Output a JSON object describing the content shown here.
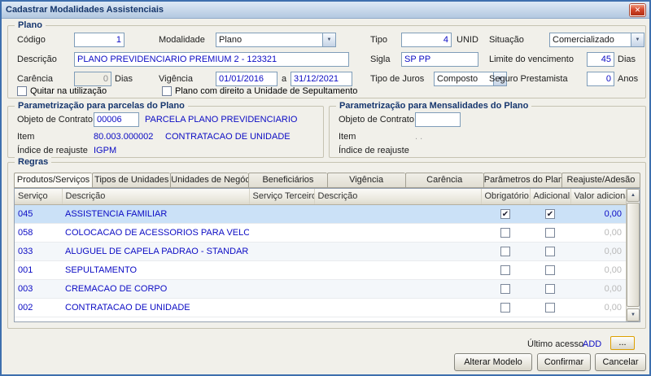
{
  "window": {
    "title": "Cadastrar Modalidades Assistenciais"
  },
  "icons": {
    "close": "✕",
    "dropdown": "▼",
    "scroll_up": "▲",
    "scroll_down": "▼"
  },
  "plano": {
    "legend": "Plano",
    "codigo": {
      "label": "Código",
      "value": "1"
    },
    "modalidade": {
      "label": "Modalidade",
      "value": "Plano"
    },
    "tipo": {
      "label": "Tipo",
      "value": "4",
      "suffix": "UNID"
    },
    "situacao": {
      "label": "Situação",
      "value": "Comercializado"
    },
    "descricao": {
      "label": "Descrição",
      "value": "PLANO PREVIDENCIARIO PREMIUM 2 - 123321"
    },
    "sigla": {
      "label": "Sigla",
      "value": "SP PP"
    },
    "limite": {
      "label": "Limite do vencimento",
      "value": "45",
      "suffix": "Dias"
    },
    "carencia": {
      "label": "Carência",
      "value": "0",
      "suffix": "Dias"
    },
    "vigencia": {
      "label": "Vigência",
      "start": "01/01/2016",
      "sep": "a",
      "end": "31/12/2021"
    },
    "juros": {
      "label": "Tipo de Juros",
      "value": "Composto"
    },
    "seguro": {
      "label": "Seguro Prestamista",
      "value": "0",
      "suffix": "Anos"
    },
    "quitar": {
      "label": "Quitar na utilização",
      "checked": ""
    },
    "direito": {
      "label": "Plano com direito a Unidade de Sepultamento",
      "checked": ""
    }
  },
  "parcelas": {
    "legend": "Parametrização para parcelas do Plano",
    "objeto": {
      "label": "Objeto de Contrato",
      "value": "00006",
      "desc": "PARCELA PLANO PREVIDENCIARIO"
    },
    "item": {
      "label": "Item",
      "value": "80.003.000002",
      "desc": "CONTRATACAO DE UNIDADE"
    },
    "indice": {
      "label": "Índice de reajuste",
      "value": "IGPM"
    }
  },
  "mensalidades": {
    "legend": "Parametrização para Mensalidades do Plano",
    "objeto": {
      "label": "Objeto de Contrato",
      "value": ""
    },
    "item": {
      "label": "Item",
      "value": ".  ."
    },
    "indice": {
      "label": "Índice de reajuste",
      "value": ""
    }
  },
  "regras": {
    "legend": "Regras",
    "tabs": [
      {
        "label": "Produtos/Serviços",
        "active": true
      },
      {
        "label": "Tipos de Unidades"
      },
      {
        "label": "Unidades de Negócio"
      },
      {
        "label": "Beneficiários"
      },
      {
        "label": "Vigência"
      },
      {
        "label": "Carência"
      },
      {
        "label": "Parâmetros do Plano"
      },
      {
        "label": "Reajuste/Adesão"
      }
    ],
    "table": {
      "headers": [
        "Serviço",
        "Descrição",
        "Serviço Terceiro",
        "Descrição",
        "Obrigatório",
        "Adicional",
        "Valor adicional"
      ],
      "rows": [
        {
          "servico": "045",
          "descricao": "ASSISTENCIA FAMILIAR",
          "servico_terceiro": "",
          "descricao2": "",
          "obrigatorio": "✔",
          "adicional": "✔",
          "valor": "0,00",
          "selected": true
        },
        {
          "servico": "058",
          "descricao": "COLOCACAO DE ACESSORIOS PARA VELORIO",
          "servico_terceiro": "",
          "descricao2": "",
          "obrigatorio": "",
          "adicional": "",
          "valor": "0,00"
        },
        {
          "servico": "033",
          "descricao": "ALUGUEL DE CAPELA PADRAO - STANDARD",
          "servico_terceiro": "",
          "descricao2": "",
          "obrigatorio": "",
          "adicional": "",
          "valor": "0,00"
        },
        {
          "servico": "001",
          "descricao": "SEPULTAMENTO",
          "servico_terceiro": "",
          "descricao2": "",
          "obrigatorio": "",
          "adicional": "",
          "valor": "0,00"
        },
        {
          "servico": "003",
          "descricao": "CREMACAO DE CORPO",
          "servico_terceiro": "",
          "descricao2": "",
          "obrigatorio": "",
          "adicional": "",
          "valor": "0,00"
        },
        {
          "servico": "002",
          "descricao": "CONTRATACAO DE UNIDADE",
          "servico_terceiro": "",
          "descricao2": "",
          "obrigatorio": "",
          "adicional": "",
          "valor": "0,00"
        }
      ]
    }
  },
  "footer": {
    "ultimo_acesso_label": "Último acesso",
    "ultimo_acesso_value": "ADD",
    "more_button": "...",
    "alterar_modelo": "Alterar Modelo",
    "confirmar": "Confirmar",
    "cancelar": "Cancelar"
  }
}
